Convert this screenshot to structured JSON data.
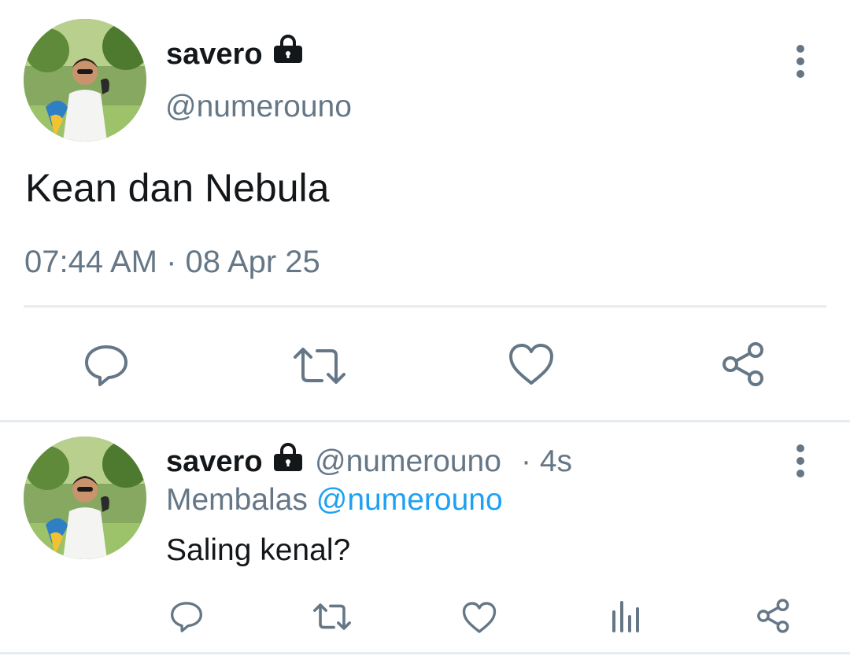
{
  "main_tweet": {
    "display_name": "savero",
    "handle": "@numerouno",
    "text": "Kean dan Nebula",
    "timestamp": "07:44 AM · 08 Apr 25",
    "protected": true,
    "icons": [
      "reply-icon",
      "retweet-icon",
      "like-icon",
      "share-icon"
    ]
  },
  "reply_tweet": {
    "display_name": "savero",
    "handle": "@numerouno",
    "time_ago": "· 4s",
    "replying_prefix": "Membalas",
    "replying_to": "@numerouno",
    "text": "Saling kenal?",
    "protected": true,
    "icons": [
      "reply-icon",
      "retweet-icon",
      "like-icon",
      "analytics-icon",
      "share-icon"
    ]
  },
  "colors": {
    "text": "#14171a",
    "secondary": "#657786",
    "link": "#1da1f2",
    "divider": "#e6ecf0"
  }
}
